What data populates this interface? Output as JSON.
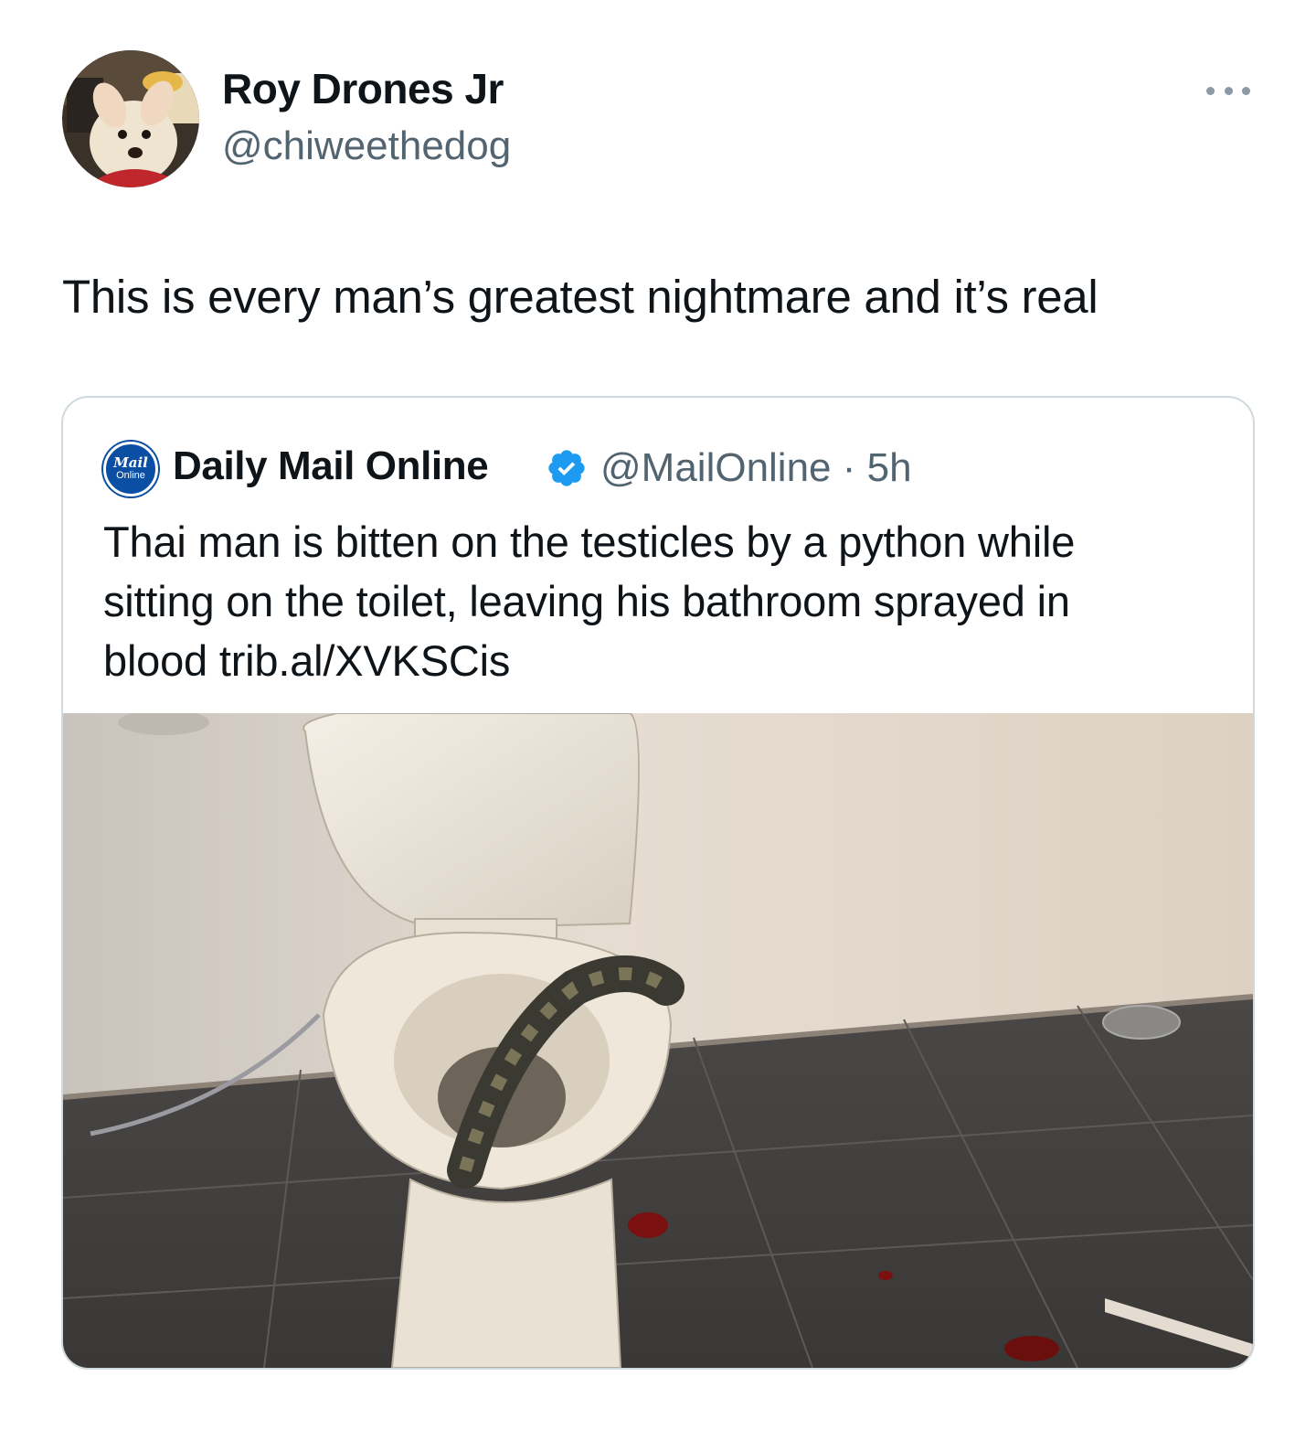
{
  "tweet": {
    "display_name": "Roy Drones Jr",
    "handle": "@chiweethedog",
    "text": "This is every man’s greatest nightmare and it’s real"
  },
  "quoted": {
    "logo_line1": "Mail",
    "logo_line2": "Online",
    "display_name": "Daily Mail Online",
    "handle": "@MailOnline",
    "separator": "·",
    "time": "5h",
    "text_lines": [
      "Thai man is bitten on the testicles by a python while",
      "sitting on the toilet, leaving his bathroom sprayed in",
      "blood trib.al/XVKSCis"
    ]
  },
  "icons": {
    "more": "more-horizontal-icon",
    "verified": "verified-badge-icon"
  },
  "colors": {
    "text_primary": "#0f1419",
    "text_secondary": "#536471",
    "verified": "#1d9bf0",
    "card_border": "#cfd9de",
    "mail_blue": "#0a4fa3"
  }
}
